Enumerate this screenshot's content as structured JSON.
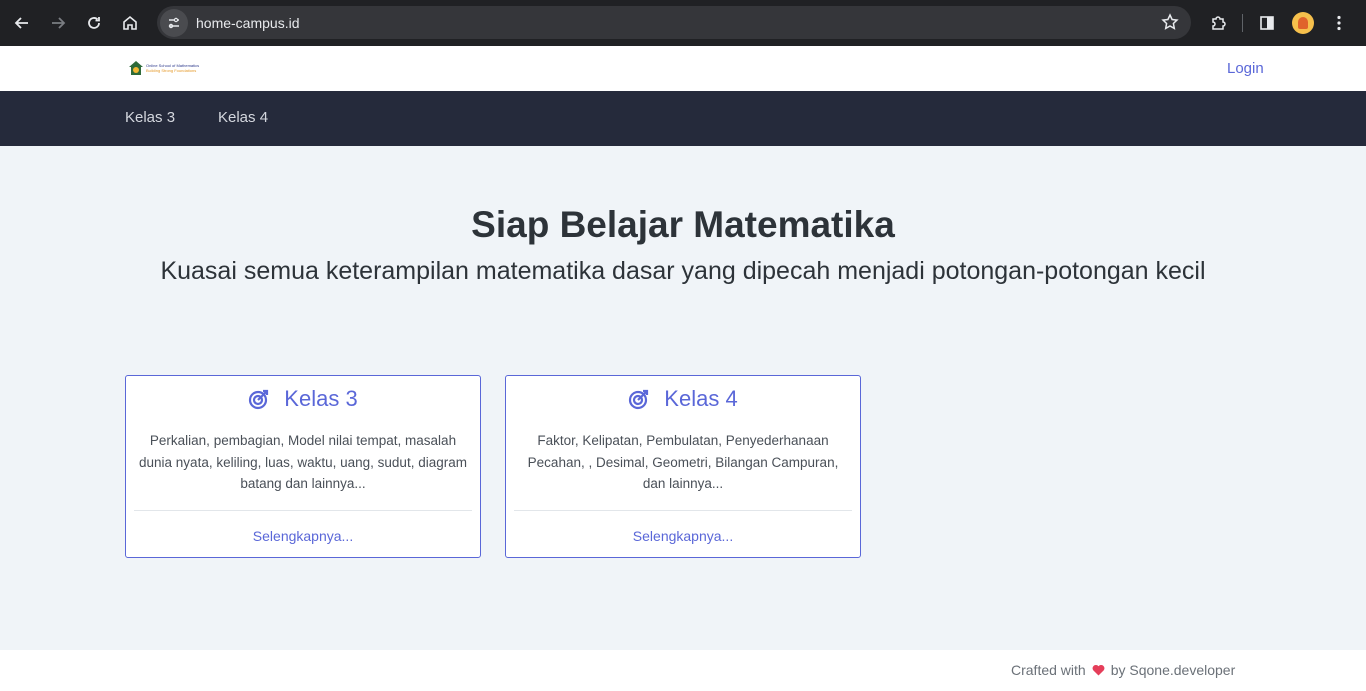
{
  "browser": {
    "url": "home-campus.id",
    "icons": [
      "back-icon",
      "forward-icon",
      "reload-icon",
      "home-icon",
      "site-info-icon",
      "bookmark-star-icon",
      "extensions-icon",
      "side-panel-icon",
      "profile-avatar",
      "menu-icon"
    ]
  },
  "header": {
    "logo_line1": "Online School of Mathematics",
    "logo_line2": "Building Strong Foundations",
    "login_label": "Login"
  },
  "nav": {
    "items": [
      {
        "label": "Kelas 3"
      },
      {
        "label": "Kelas 4"
      }
    ]
  },
  "hero": {
    "title": "Siap Belajar Matematika",
    "subtitle": "Kuasai semua keterampilan matematika dasar yang dipecah menjadi potongan-potongan kecil"
  },
  "cards": [
    {
      "title": "Kelas 3",
      "description": "Perkalian, pembagian, Model nilai tempat, masalah dunia nyata, keliling, luas, waktu, uang, sudut, diagram batang dan lainnya...",
      "link_label": "Selengkapnya..."
    },
    {
      "title": "Kelas 4",
      "description": "Faktor, Kelipatan, Pembulatan, Penyederhanaan Pecahan, , Desimal, Geometri, Bilangan Campuran, dan lainnya...",
      "link_label": "Selengkapnya..."
    }
  ],
  "footer": {
    "crafted_prefix": "Crafted with",
    "crafted_suffix": "by Sqone.developer"
  },
  "colors": {
    "accent": "#5a67d8",
    "nav_bg": "#252a3b",
    "page_bg": "#f0f4f8",
    "heart": "#e53e5a"
  }
}
